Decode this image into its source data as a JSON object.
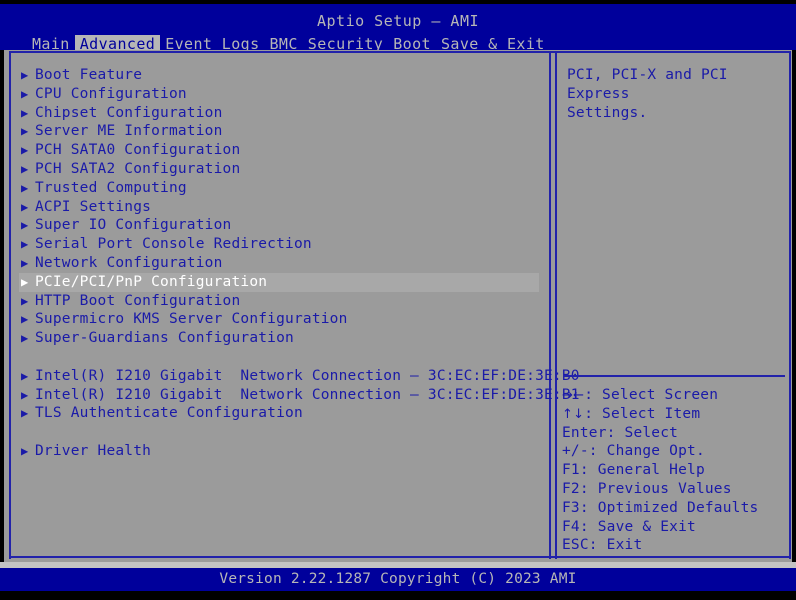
{
  "header": {
    "title": "Aptio Setup – AMI",
    "tabs": [
      {
        "label": "Main",
        "active": false
      },
      {
        "label": "Advanced",
        "active": true
      },
      {
        "label": "Event Logs",
        "active": false
      },
      {
        "label": "BMC",
        "active": false
      },
      {
        "label": "Security",
        "active": false
      },
      {
        "label": "Boot",
        "active": false
      },
      {
        "label": "Save & Exit",
        "active": false
      }
    ]
  },
  "menu": {
    "items": [
      {
        "label": "Boot Feature",
        "arrow": "▶",
        "selected": false,
        "gap_after": false
      },
      {
        "label": "CPU Configuration",
        "arrow": "▶",
        "selected": false,
        "gap_after": false
      },
      {
        "label": "Chipset Configuration",
        "arrow": "▶",
        "selected": false,
        "gap_after": false
      },
      {
        "label": "Server ME Information",
        "arrow": "▶",
        "selected": false,
        "gap_after": false
      },
      {
        "label": "PCH SATA0 Configuration",
        "arrow": "▶",
        "selected": false,
        "gap_after": false
      },
      {
        "label": "PCH SATA2 Configuration",
        "arrow": "▶",
        "selected": false,
        "gap_after": false
      },
      {
        "label": "Trusted Computing",
        "arrow": "▶",
        "selected": false,
        "gap_after": false
      },
      {
        "label": "ACPI Settings",
        "arrow": "▶",
        "selected": false,
        "gap_after": false
      },
      {
        "label": "Super IO Configuration",
        "arrow": "▶",
        "selected": false,
        "gap_after": false
      },
      {
        "label": "Serial Port Console Redirection",
        "arrow": "▶",
        "selected": false,
        "gap_after": false
      },
      {
        "label": "Network Configuration",
        "arrow": "▶",
        "selected": false,
        "gap_after": false
      },
      {
        "label": "PCIe/PCI/PnP Configuration",
        "arrow": "▶",
        "selected": true,
        "gap_after": false
      },
      {
        "label": "HTTP Boot Configuration",
        "arrow": "▶",
        "selected": false,
        "gap_after": false
      },
      {
        "label": "Supermicro KMS Server Configuration",
        "arrow": "▶",
        "selected": false,
        "gap_after": false
      },
      {
        "label": "Super-Guardians Configuration",
        "arrow": "▶",
        "selected": false,
        "gap_after": true
      },
      {
        "label": "Intel(R) I210 Gigabit  Network Connection – 3C:EC:EF:DE:3E:B0",
        "arrow": "▶",
        "selected": false,
        "gap_after": false
      },
      {
        "label": "Intel(R) I210 Gigabit  Network Connection – 3C:EC:EF:DE:3E:B1",
        "arrow": "▶",
        "selected": false,
        "gap_after": false
      },
      {
        "label": "TLS Authenticate Configuration",
        "arrow": "▶",
        "selected": false,
        "gap_after": true
      },
      {
        "label": "Driver Health",
        "arrow": "▶",
        "selected": false,
        "gap_after": false
      }
    ]
  },
  "help": {
    "text": "PCI, PCI-X and PCI Express\nSettings.",
    "legend": [
      {
        "glyph": "→←",
        "text": ": Select Screen"
      },
      {
        "glyph": "↑↓",
        "text": ": Select Item"
      },
      {
        "glyph": "",
        "text": "Enter: Select"
      },
      {
        "glyph": "",
        "text": "+/-: Change Opt."
      },
      {
        "glyph": "",
        "text": "F1: General Help"
      },
      {
        "glyph": "",
        "text": "F2: Previous Values"
      },
      {
        "glyph": "",
        "text": "F3: Optimized Defaults"
      },
      {
        "glyph": "",
        "text": "F4: Save & Exit"
      },
      {
        "glyph": "",
        "text": "ESC: Exit"
      }
    ]
  },
  "footer": {
    "version": "Version 2.22.1287 Copyright (C) 2023 AMI"
  },
  "colors": {
    "header_blue": "#00009b",
    "panel_gray": "#9b9b9b",
    "text_blue": "#1a1aa8",
    "text_gray": "#b6b6b6",
    "selected_text": "#ffffff",
    "border_blue": "#2222aa"
  }
}
